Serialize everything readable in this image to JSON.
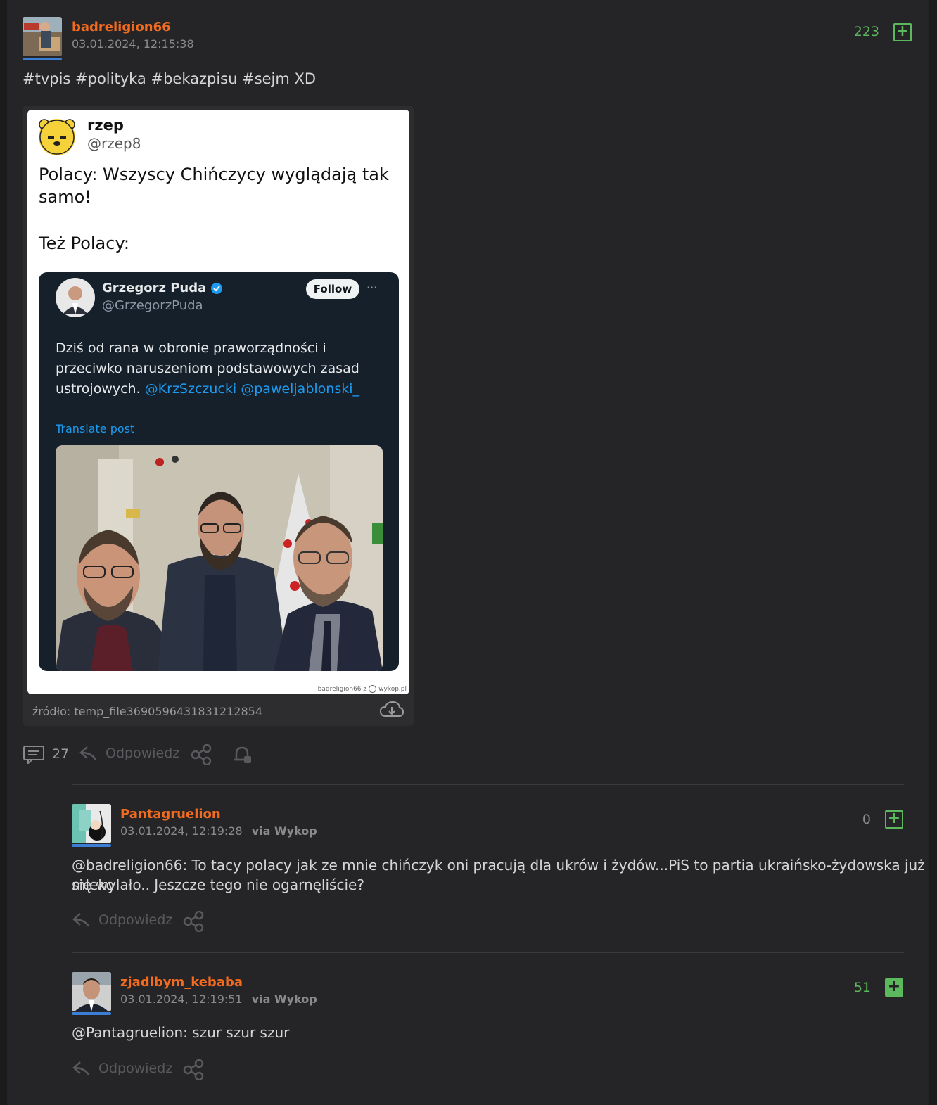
{
  "post": {
    "author": "badreligion66",
    "date": "03.01.2024, 12:15:38",
    "votes": "223",
    "text": "#tvpis #polityka #bekazpisu #sejm XD",
    "source_label": "źródło: temp_file3690596431831212854",
    "comments_count": "27",
    "reply_label": "Odpowiedz",
    "embedded": {
      "name": "rzep",
      "handle": "@rzep8",
      "line1": "Polacy: Wszyscy Chińczycy wyglądają tak",
      "line2": "samo!",
      "line3": "Też Polacy:",
      "watermark_user": "badreligion66 z",
      "watermark_site": "wykop.pl",
      "inner": {
        "name": "Grzegorz Puda",
        "handle": "@GrzegorzPuda",
        "follow": "Follow",
        "more": "···",
        "text1": "Dziś od rana w obronie praworządności i",
        "text2": "przeciwko naruszeniom podstawowych zasad",
        "text3": "ustrojowych.",
        "mention1": "@KrzSzczucki",
        "mention2": "@paweljablonski_",
        "translate": "Translate post"
      }
    }
  },
  "comments": [
    {
      "author": "Pantagruelion",
      "date": "03.01.2024, 12:19:28",
      "via": "via Wykop",
      "votes": "0",
      "text1": "@badreligion66: To tacy polacy jak ze mnie chińczyk oni pracują dla ukrów i żydów...PiS to partia ukraińsko-żydowska już mleko",
      "text2": "się wylało.. Jeszcze tego nie ogarnęliście?",
      "reply_label": "Odpowiedz"
    },
    {
      "author": "zjadlbym_kebaba",
      "date": "03.01.2024, 12:19:51",
      "via": "via Wykop",
      "votes": "51",
      "text1": "@Pantagruelion: szur szur szur",
      "reply_label": "Odpowiedz"
    }
  ],
  "colors": {
    "username": "#f36b1f",
    "vote_positive": "#5cb85c",
    "vote_zero": "#8a8a8a",
    "link_blue": "#1d9bf0",
    "avatar_bar": "#3b7ed6"
  },
  "icons": [
    "plus-icon",
    "comments-icon",
    "reply-icon",
    "share-icon",
    "bell-icon",
    "cloud-download-icon",
    "verified-icon"
  ]
}
